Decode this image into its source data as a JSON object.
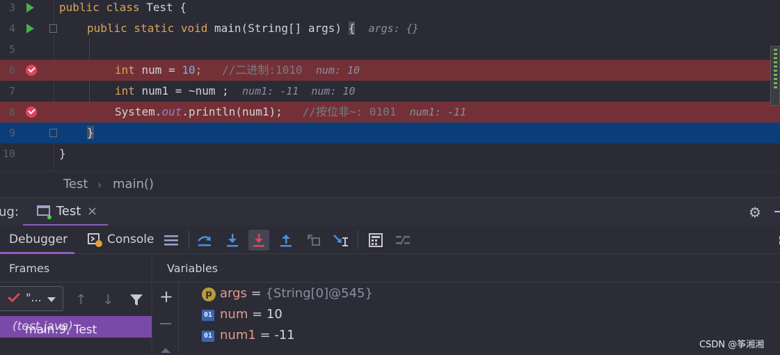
{
  "editor": {
    "lines": [
      {
        "num": "3",
        "code_tokens": [
          {
            "t": "public class Test {",
            "c": "plain"
          }
        ]
      },
      {
        "num": "4",
        "code_tokens": [
          {
            "t": "public static void main(String[] args) ",
            "c": "plain"
          },
          {
            "t": "{",
            "c": "brace"
          }
        ],
        "hint": "args: {}"
      },
      {
        "num": "5"
      },
      {
        "num": "6",
        "kw": "int",
        "code": " num = ",
        "value": "10",
        "semi": ";",
        "comment": "//二进制:1010",
        "hint": "num: 10"
      },
      {
        "num": "7",
        "kw": "int",
        "code": " num1 = ~num ;",
        "hint": "num1: -11  num: 10"
      },
      {
        "num": "8",
        "code_pre": "System.",
        "field": "out",
        "code_post": ".println(num1);",
        "comment": "//按位非~: 0101",
        "hint": "num1: -11"
      },
      {
        "num": "9",
        "code": "}"
      },
      {
        "num": "10",
        "code": "}"
      }
    ],
    "line3_code": "public class Test {",
    "line4_code": "public static void main(String[] args) ",
    "line4_brace": "{",
    "line4_hint": "args: {}",
    "line6_kw": "int",
    "line6_code": " num = ",
    "line6_value": "10",
    "line6_semi": ";",
    "line6_comment": "//二进制:1010",
    "line6_hint": "num: 10",
    "line7_kw": "int",
    "line7_code": " num1 = ~num ;",
    "line7_hint": "num1: -11  num: 10",
    "line8_pre": "System.",
    "line8_field": "out",
    "line8_post": ".println(num1);",
    "line8_comment": "//按位非~: 0101",
    "line8_hint": "num1: -11",
    "line9_code": "}",
    "line10_code": "}"
  },
  "breadcrumb": {
    "class_name": "Test",
    "separator": "›",
    "method_name": "main()"
  },
  "debug_window": {
    "title": "ug:",
    "tab_label": "Test",
    "tab_close": "×"
  },
  "toolbar": {
    "debugger_tab": "Debugger",
    "console_tab": "Console"
  },
  "frames": {
    "title": "Frames",
    "thread_name": "\"...",
    "selected_frame_prefix": "main:9, Test ",
    "selected_frame_file": "(test.java)"
  },
  "variables": {
    "title": "Variables",
    "items": [
      {
        "icon": "p",
        "name": "args",
        "eq": " = ",
        "value": "{String[0]@545}"
      },
      {
        "icon": "01",
        "name": "num",
        "eq": " = ",
        "value": "10"
      },
      {
        "icon": "01",
        "name": "num1",
        "eq": " = ",
        "value": "-11"
      }
    ]
  },
  "watermark": "CSDN @筝湘湘",
  "colors": {
    "breakpoint_line": "#733137",
    "execution_line": "#0b3e78",
    "accent": "#8f5cc1",
    "keyword": "#d9a55b"
  }
}
